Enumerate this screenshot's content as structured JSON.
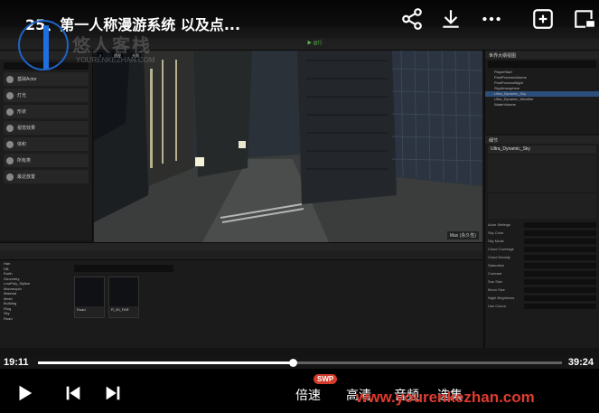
{
  "video": {
    "title": "25、第一人称漫游系统   以及点...",
    "time_current": "19:11",
    "time_total": "39:24",
    "progress": 0.487
  },
  "watermark": {
    "logo_text": "悠人客栈",
    "url_text": "YOURENKEZHAN.COM",
    "site": "www.yourenkezhan.com"
  },
  "controls": {
    "speed_label": "倍速",
    "quality_label": "高清",
    "audio_label": "音频",
    "episodes_label": "选集",
    "swp_badge": "SWP"
  },
  "editor": {
    "play_label": "▶ 运行",
    "viewport_label": "Max (永久性)",
    "outliner_tab": "世界大纲视图",
    "details_tab": "细节",
    "selected_actor": "Ultra_Dynamic_Sky",
    "outliner_rows": [
      "PlayerStart",
      "PostProcessVolume",
      "PostProcessNight",
      "SkyAtmosphere",
      "Ultra_Dynamic_Sky",
      "Ultra_Dynamic_Weather",
      "WaterVolume"
    ],
    "left_items": [
      "基础Actor",
      "灯光",
      "形状",
      "视觉效果",
      "体积",
      "所有类",
      "最近放置"
    ],
    "cb_tree": [
      "Hair",
      "DB",
      "Earth",
      "Geometry",
      "LowPoly_Stylize",
      "Mannequin",
      "Material",
      "Mesh",
      "Building",
      "Ring",
      "Sky",
      "Road"
    ],
    "assets": [
      "Road",
      "R_00_FAR"
    ],
    "prop_labels": [
      "Actor Settings",
      "Sky Color",
      "Sky Mode",
      "Cloud Coverage",
      "Cloud Density",
      "Saturation",
      "Contrast",
      "Sun Size",
      "Moon Size",
      "Night Brightness",
      "Use Colour"
    ]
  }
}
